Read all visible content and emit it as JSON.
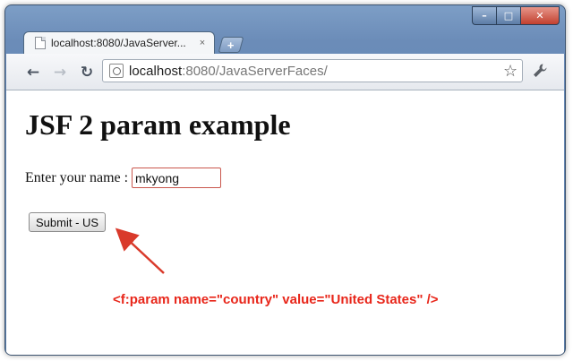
{
  "browser": {
    "tab_title": "localhost:8080/JavaServer...",
    "tab_close": "×",
    "new_tab": "+",
    "url_host": "localhost",
    "url_path": ":8080/JavaServerFaces/",
    "window_controls": {
      "minimize": "–",
      "maximize": "□",
      "close": "✕"
    },
    "nav": {
      "back": "←",
      "forward": "→",
      "reload": "↻"
    },
    "star": "☆",
    "wrench": "🔧"
  },
  "page": {
    "heading": "JSF 2 param example",
    "name_label": "Enter your name :",
    "name_value": "mkyong",
    "submit_label": "Submit - US"
  },
  "annotation": {
    "text": "<f:param name=\"country\" value=\"United States\" />",
    "color": "#e8261a"
  }
}
